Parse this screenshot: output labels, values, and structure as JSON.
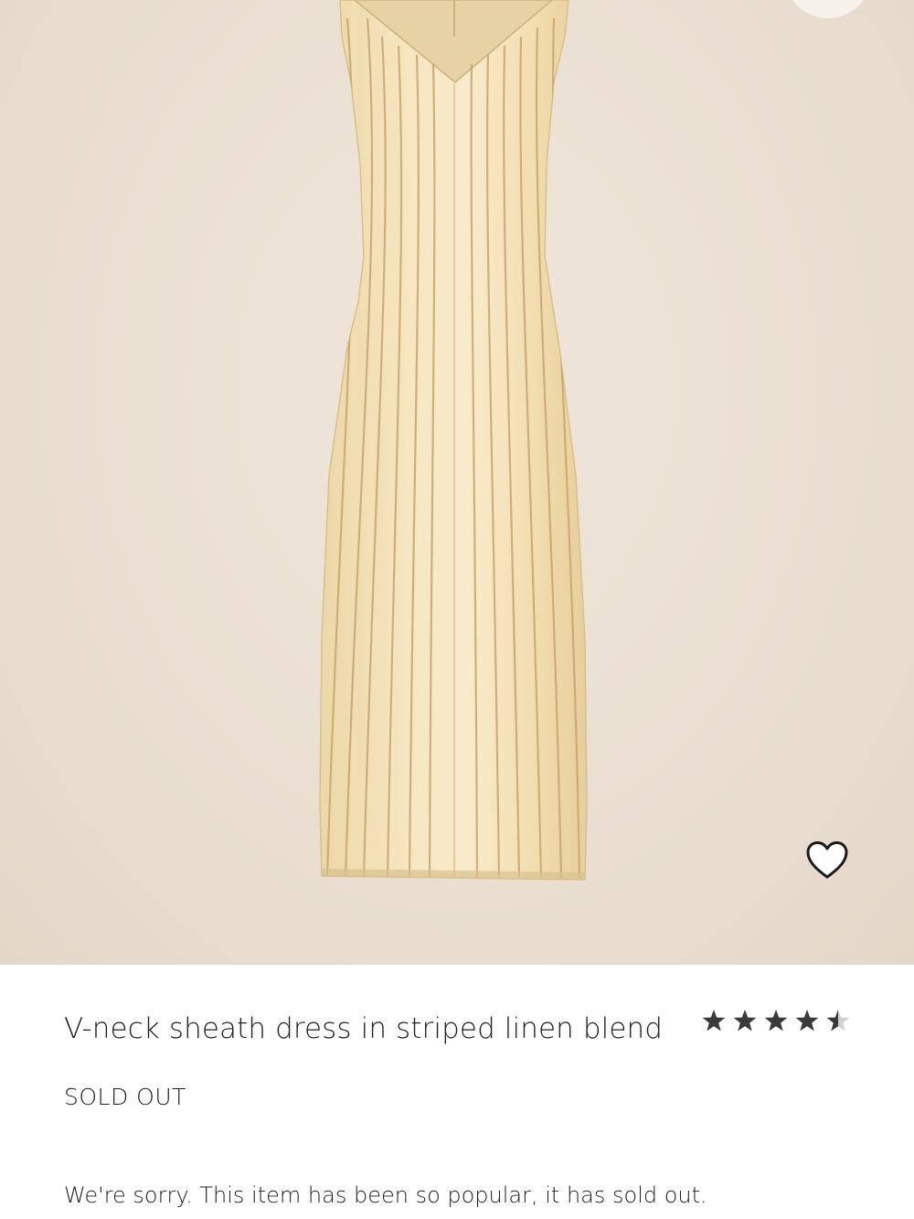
{
  "product": {
    "title": "V-neck sheath dress in striped linen blend",
    "status": "SOLD OUT",
    "message": "We're sorry. This item has been so popular, it has sold out.",
    "rating": 4.5,
    "image_icon": "product-image",
    "wishlist_icon": "heart-outline-icon"
  },
  "colors": {
    "background": "#ebe1d4",
    "dress": "#f3e2b8",
    "stripe": "#c8a56e",
    "star": "#3a3a3a"
  }
}
